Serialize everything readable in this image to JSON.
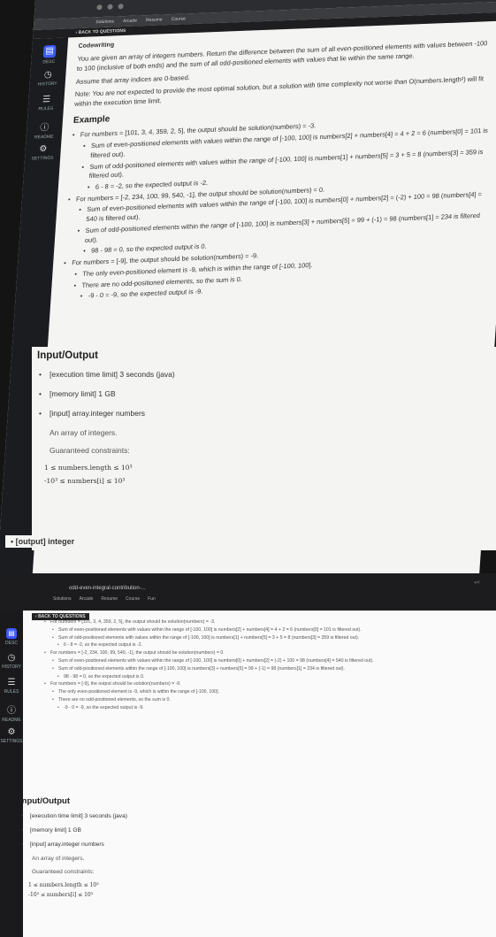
{
  "top": {
    "tabs": [
      "Solutions",
      "Arcade",
      "Resume",
      "Course"
    ],
    "back_label": "BACK TO QUESTIONS",
    "nav": [
      {
        "label": "DESC",
        "icon": "document-icon"
      },
      {
        "label": "HISTORY",
        "icon": "clock-icon"
      },
      {
        "label": "RULES",
        "icon": "list-icon"
      },
      {
        "label": "README",
        "icon": "info-icon"
      },
      {
        "label": "SETTINGS",
        "icon": "gear-icon"
      }
    ],
    "codewriting": "Codewriting",
    "intro": "You are given an array of integers numbers. Return the difference between the sum of all even-positioned elements with values between -100 to 100 (inclusive of both ends) and the sum of all odd-positioned elements with values that lie within the same range.",
    "assume": "Assume that array indices are 0-based.",
    "note": "Note: You are not expected to provide the most optimal solution, but a solution with time complexity not worse than O(numbers.length²) will fit within the execution time limit.",
    "example_heading": "Example",
    "examples": [
      {
        "main": "For numbers = [101, 3, 4, 359, 2, 5], the output should be solution(numbers) = -3.",
        "subs": [
          "Sum of even-positioned elements with values within the range of [-100, 100] is numbers[2] + numbers[4] = 4 + 2 = 6 (numbers[0] = 101 is filtered out).",
          "Sum of odd-positioned elements with values within the range of [-100, 100] is numbers[1] + numbers[5] = 3 + 5 = 8 (numbers[3] = 359 is filtered out).",
          "6 - 8 = -2, so the expected output is -2."
        ]
      },
      {
        "main": "For numbers = [-2, 234, 100, 99, 540, -1], the output should be solution(numbers) = 0.",
        "subs": [
          "Sum of even-positioned elements with values within the range of [-100, 100] is numbers[0] + numbers[2] = (-2) + 100 = 98 (numbers[4] = 540 is filtered out).",
          "Sum of odd-positioned elements within the range of [-100, 100] is numbers[3] + numbers[5] = 99 + (-1) = 98 (numbers[1] = 234 is filtered out).",
          "98 - 98 = 0, so the expected output is 0."
        ]
      },
      {
        "main": "For numbers = [-9], the output should be solution(numbers) = -9.",
        "subs": [
          "The only even-positioned element is -9, which is within the range of [-100, 100].",
          "There are no odd-positioned elements, so the sum is 0.",
          "-9 - 0 = -9, so the expected output is -9."
        ]
      }
    ],
    "io_heading": "Input/Output",
    "io_items": [
      "[execution time limit] 3 seconds (java)",
      "[memory limit] 1 GB",
      "[input] array.integer numbers"
    ],
    "input_desc": "An array of integers.",
    "guaranteed": "Guaranteed constraints:",
    "constraint1": "1 ≤ numbers.length ≤ 10³",
    "constraint2": "-10³ ≤ numbers[i] ≤ 10³",
    "output_item": "[output] integer"
  },
  "bottom": {
    "url": "odd-even-integral-contribution-...",
    "tabs": [
      "Solutions",
      "Arcade",
      "Resume",
      "Course",
      "Fun"
    ],
    "back_label": "BACK TO QUESTIONS",
    "zoom": "«<",
    "nav": [
      {
        "label": "DESC",
        "icon": "document-icon"
      },
      {
        "label": "HISTORY",
        "icon": "clock-icon"
      },
      {
        "label": "RULES",
        "icon": "list-icon"
      },
      {
        "label": "README",
        "icon": "info-icon"
      },
      {
        "label": "SETTINGS",
        "icon": "gear-icon"
      }
    ],
    "io_heading": "Input/Output",
    "io_items": [
      "[execution time limit] 3 seconds (java)",
      "[memory limit] 1 GB",
      "[input] array.integer numbers"
    ],
    "input_desc": "An array of integers.",
    "guaranteed": "Guaranteed constraints:",
    "constraint1": "1 ≤ numbers.length ≤ 10³",
    "constraint2": "-10³ ≤ numbers[i] ≤ 10³"
  }
}
